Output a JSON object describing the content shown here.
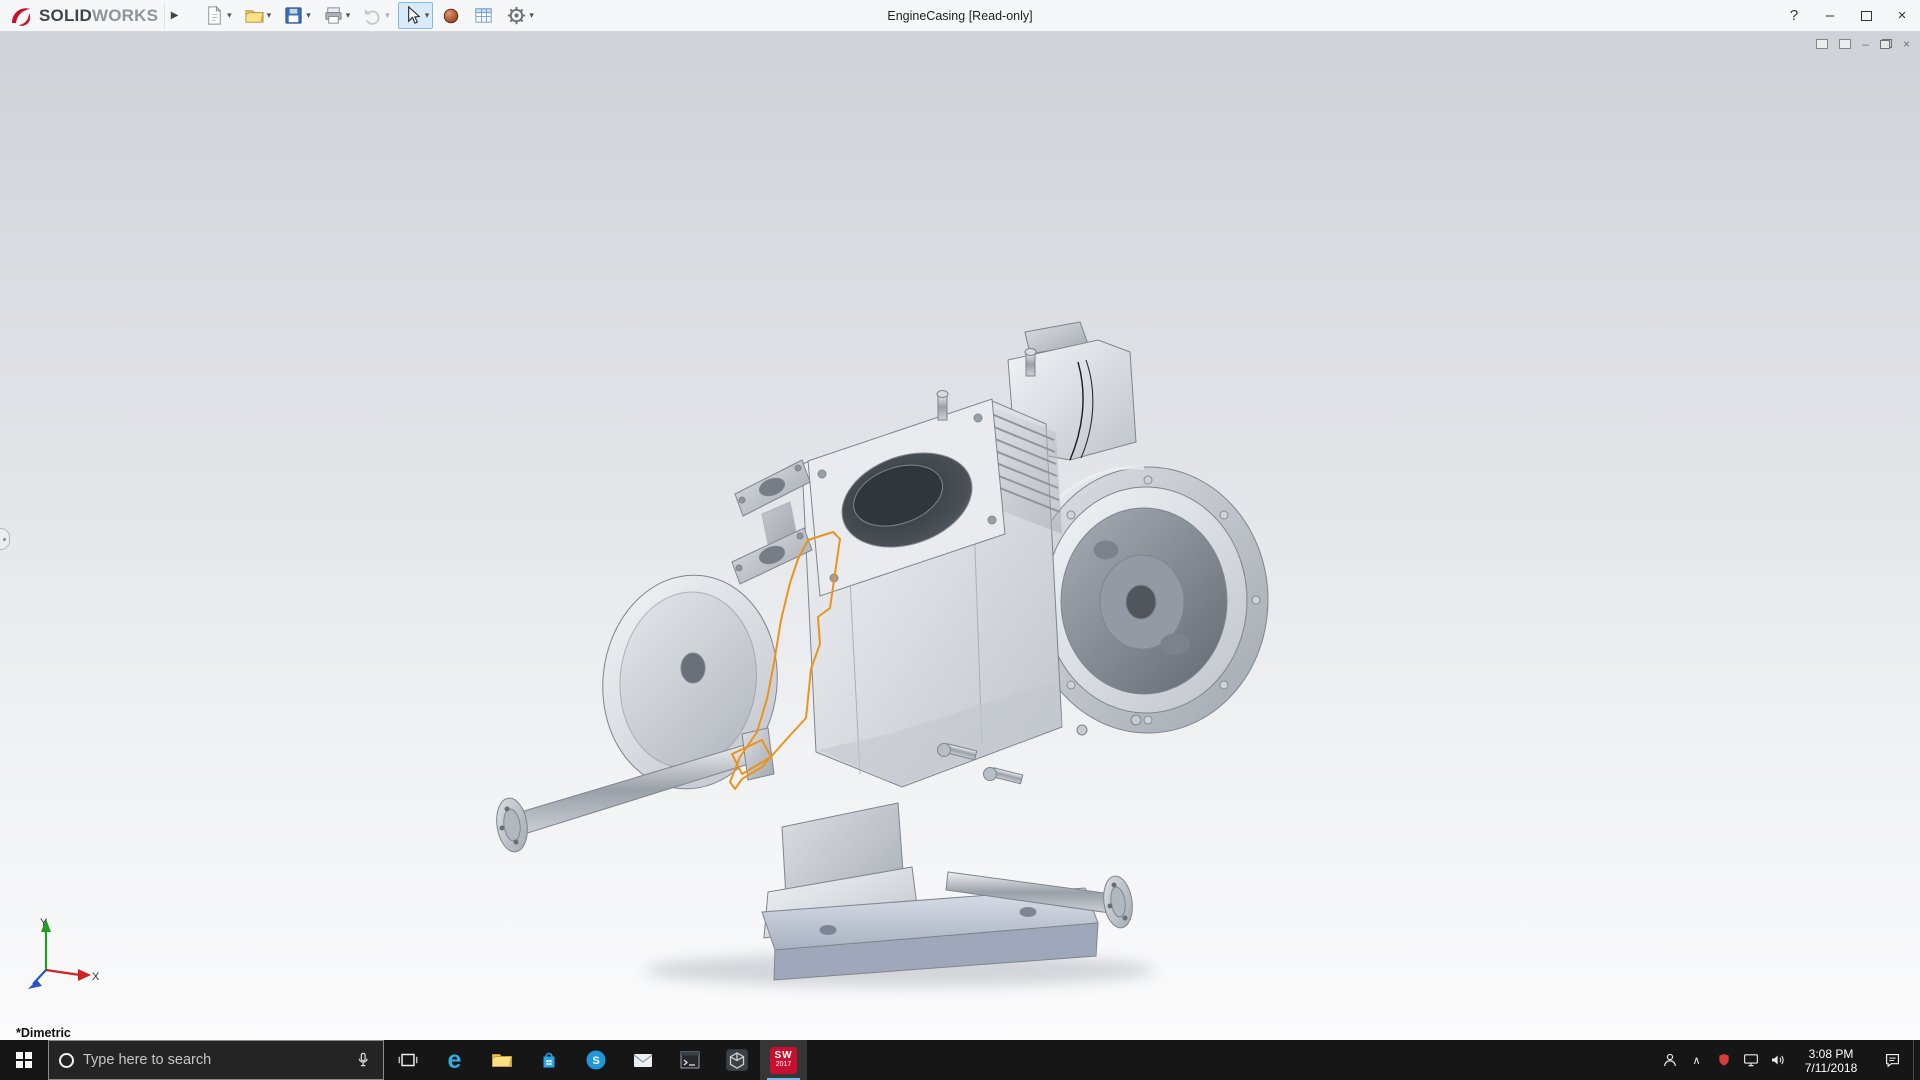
{
  "app": {
    "brand_bold": "SOLID",
    "brand_light": "WORKS",
    "flyout_arrow": "▶"
  },
  "titlebar": {
    "document_title": "EngineCasing [Read-only]",
    "help_label": "?",
    "minimize_glyph": "–",
    "close_glyph": "×"
  },
  "toolbar": {
    "dropdown_glyph": "▾",
    "items": [
      "new-document-icon",
      "open-icon",
      "save-icon",
      "print-icon",
      "undo-icon",
      "select-cursor-icon",
      "appearance-icon",
      "design-table-icon",
      "options-gear-icon"
    ]
  },
  "document_window": {
    "minimize_glyph": "–",
    "close_glyph": "×"
  },
  "viewport": {
    "view_orientation_label": "*Dimetric",
    "triad_x_label": "X",
    "triad_y_label": "Y"
  },
  "taskbar": {
    "search_placeholder": "Type here to search",
    "edge_glyph": "e",
    "skype_glyph": "S",
    "sw_badge_line1": "SW",
    "sw_badge_line2": "2017",
    "hidden_icons_glyph": "∧",
    "clock_time": "3:08 PM",
    "clock_date": "7/11/2018"
  },
  "colors": {
    "solidworks_red": "#c8102e",
    "taskbar_background": "#161616",
    "active_app_underline": "#76b9ed",
    "sketch_highlight_orange": "#e8941f"
  }
}
